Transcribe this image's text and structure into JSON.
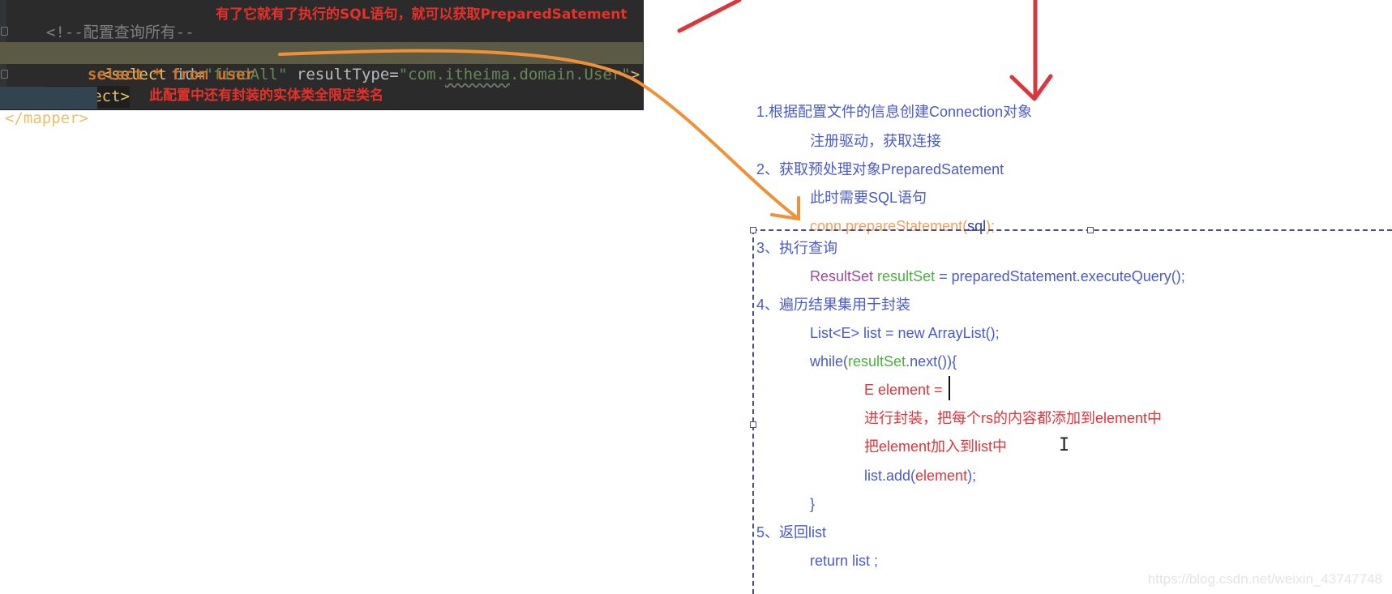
{
  "editor": {
    "lines": {
      "comment_prefix": "<!--配置查询所有--",
      "select_open_tag": "<select",
      "select_id_attr": " id=",
      "select_id_value": "\"findAll\"",
      "select_rt_attr": " resultType=",
      "select_rt_value_prefix": "\"com.",
      "select_rt_value_squiggle": "itheima",
      "select_rt_value_suffix": ".domain.User\"",
      "select_open_end": ">",
      "sql": "select * from user",
      "select_close": "</select>",
      "mapper_close": "</mapper>"
    },
    "annotations": {
      "top": "有了它就有了执行的SQL语句，就可以获取PreparedSatement",
      "bottom": "此配置中还有封装的实体类全限定类名"
    }
  },
  "notes": {
    "step1": "1.根据配置文件的信息创建Connection对象",
    "step1_sub": "注册驱动，获取连接",
    "step2": "2、获取预处理对象PreparedSatement",
    "step2_sub": "此时需要SQL语句",
    "step2_code_a": "conn.prepareStatement(",
    "step2_code_b": "sql",
    "step2_code_c": ");",
    "step3": "3、执行查询",
    "step3_code_type": "ResultSet",
    "step3_code_var": " resultSet",
    "step3_code_rest": " = preparedStatement.executeQuery();",
    "step4": "4、遍历结果集用于封装",
    "step4_list": "List<E> list = new ArrayList();",
    "step4_while_a": "while(",
    "step4_while_b": "resultSet",
    "step4_while_c": ".next()){",
    "step4_elem": "E element =",
    "step4_wrap": "进行封装，把每个rs的内容都添加到element中",
    "step4_add_desc": "把element加入到list中",
    "step4_add_a": "list.add(",
    "step4_add_b": "element",
    "step4_add_c": ");",
    "step4_close": "}",
    "step5": "5、返回list",
    "step5_code": "return list ;"
  },
  "watermark": "https://blog.csdn.net/weixin_43747748",
  "colors": {
    "editor_bg": "#2b2b2b",
    "annotation_red": "#e8302a",
    "note_blue": "#4b5bc4",
    "arrow_orange": "#f0913a",
    "arrow_red": "#d9363e"
  }
}
